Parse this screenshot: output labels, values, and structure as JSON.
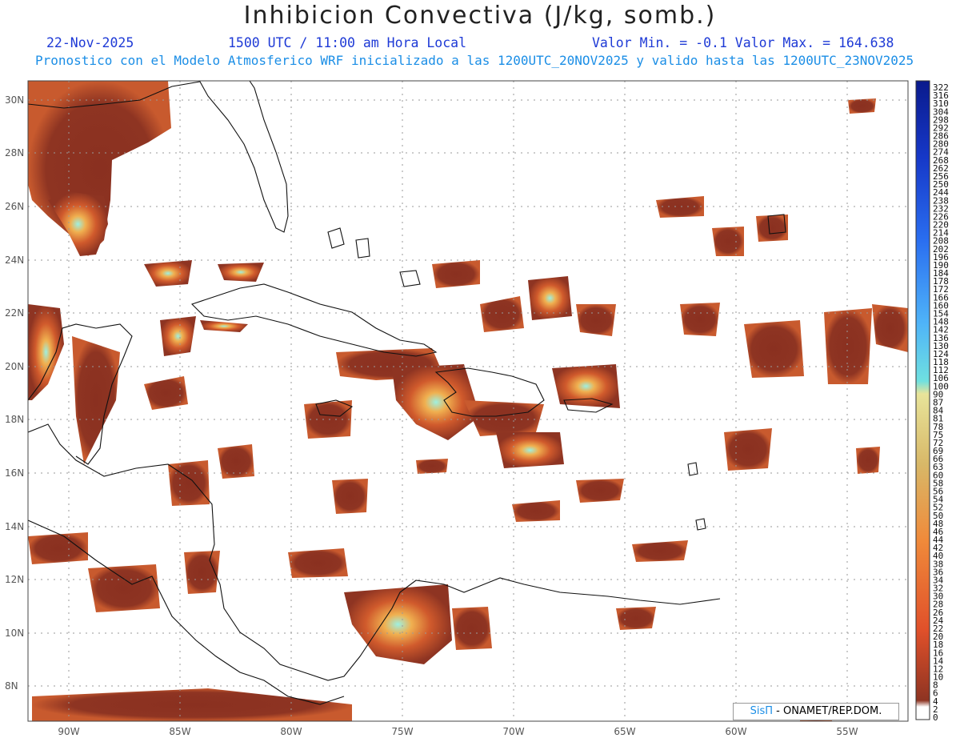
{
  "header": {
    "title": "Inhibicion Convectiva (J/kg, somb.)",
    "date": "22-Nov-2025",
    "time": "1500 UTC / 11:00 am Hora Local",
    "min_max": "Valor Min. = -0.1  Valor Max. = 164.638",
    "forecast": "Pronostico con el Modelo Atmosferico WRF inicializado a las 1200UTC_20NOV2025 y valido hasta las  1200UTC_23NOV2025"
  },
  "axes": {
    "lat_labels": [
      "30N",
      "28N",
      "26N",
      "24N",
      "22N",
      "20N",
      "18N",
      "16N",
      "14N",
      "12N",
      "10N",
      "8N"
    ],
    "lon_labels": [
      "90W",
      "85W",
      "80W",
      "75W",
      "70W",
      "65W",
      "60W",
      "55W"
    ]
  },
  "colorbar": {
    "labels": [
      "322",
      "316",
      "310",
      "304",
      "298",
      "292",
      "286",
      "280",
      "274",
      "268",
      "262",
      "256",
      "250",
      "244",
      "238",
      "232",
      "226",
      "220",
      "214",
      "208",
      "202",
      "196",
      "190",
      "184",
      "178",
      "172",
      "166",
      "160",
      "154",
      "148",
      "142",
      "136",
      "130",
      "124",
      "118",
      "112",
      "106",
      "100",
      "90",
      "87",
      "84",
      "81",
      "78",
      "75",
      "72",
      "69",
      "66",
      "63",
      "60",
      "58",
      "56",
      "54",
      "52",
      "50",
      "48",
      "46",
      "44",
      "42",
      "40",
      "38",
      "36",
      "34",
      "32",
      "30",
      "28",
      "26",
      "24",
      "22",
      "20",
      "18",
      "16",
      "14",
      "12",
      "10",
      "8",
      "6",
      "4",
      "2",
      "0"
    ],
    "colors": {
      "deep_blue": "#0a1a8c",
      "blue": "#2a6ef0",
      "light_blue": "#4fb4f8",
      "cyan": "#6fe0e0",
      "tan": "#d8c070",
      "orange": "#f08a3a",
      "red_orange": "#e0502a",
      "brown": "#8e3422",
      "white": "#ffffff"
    }
  },
  "credit": {
    "brand": "SisΠ",
    "text": " - ONAMET/REP.DOM."
  },
  "colors": {
    "field_fill": "#8e3422",
    "field_edge": "#c85a2e",
    "hot_core": "#f0a040",
    "max_core": "#9ef0e0",
    "coast": "#111111",
    "grid": "#9a9a9a"
  }
}
